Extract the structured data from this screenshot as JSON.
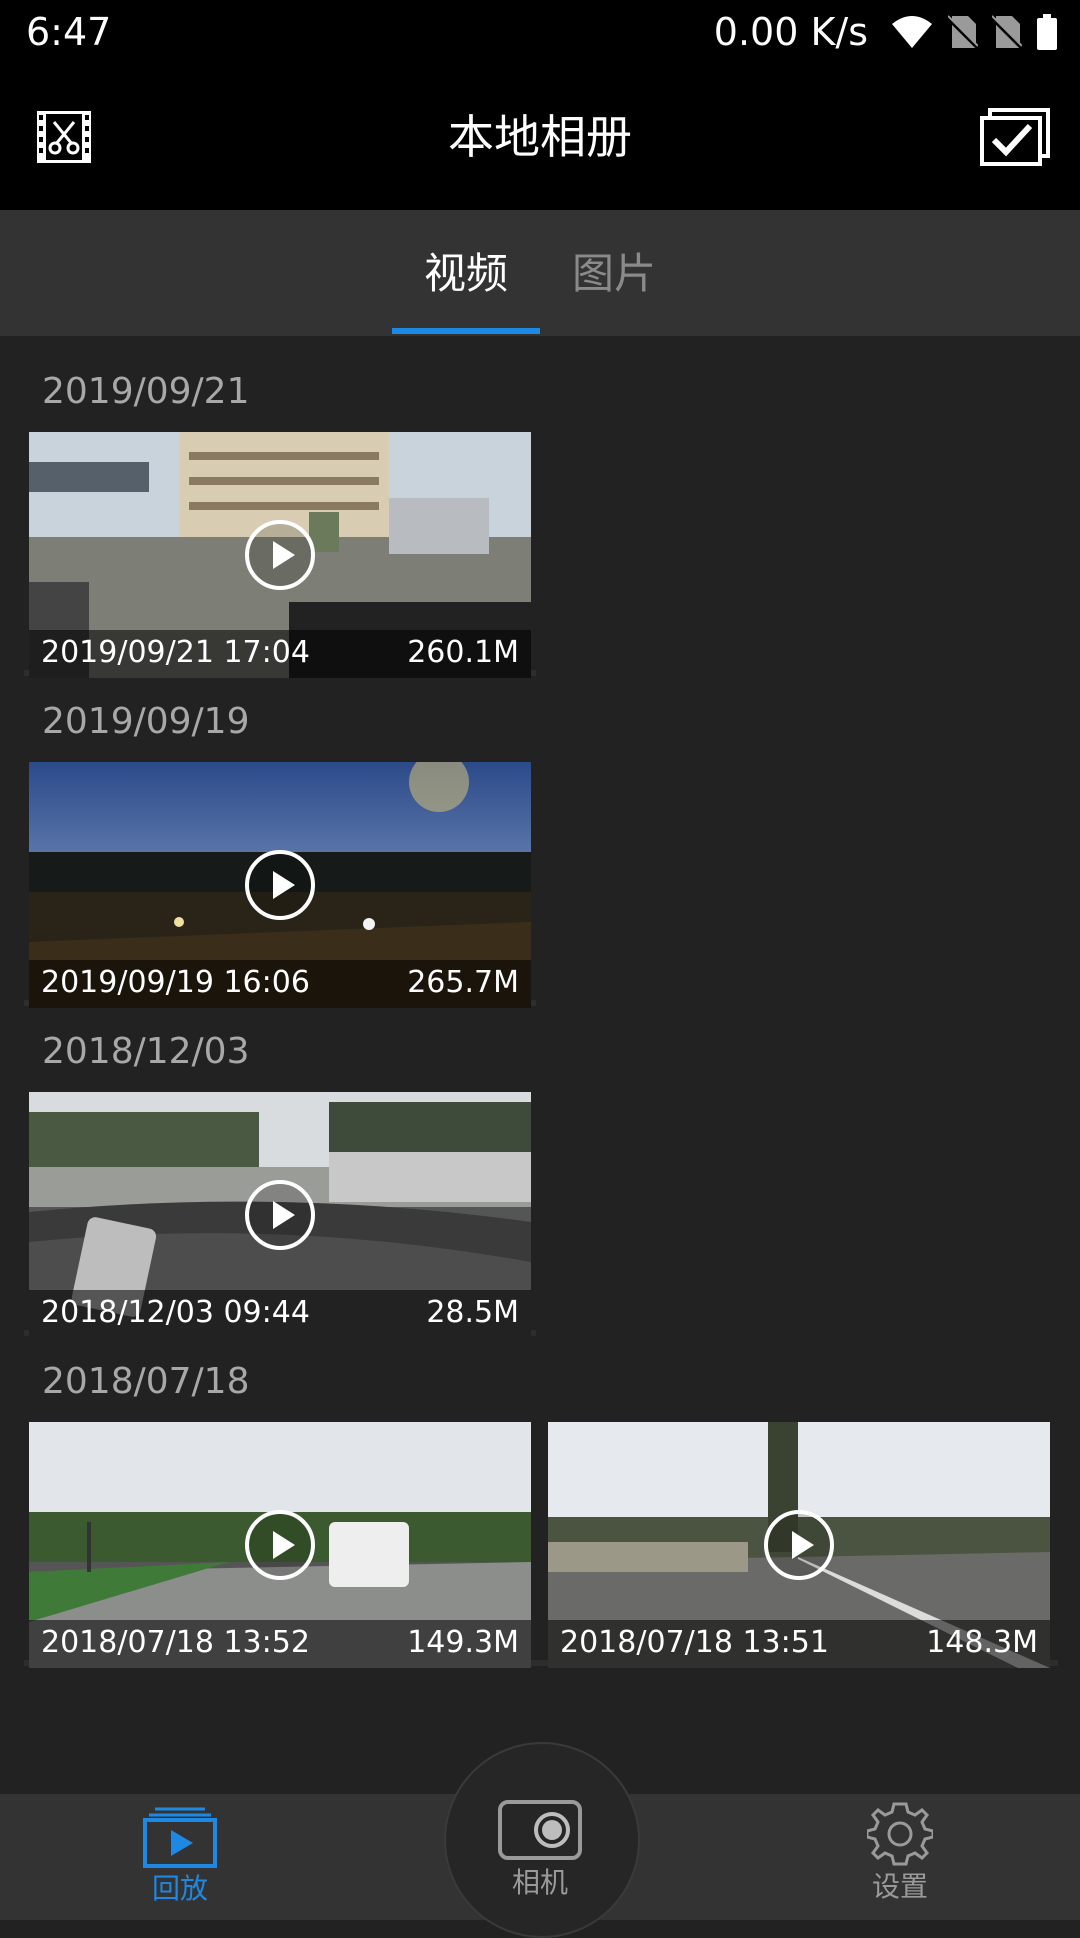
{
  "status_bar": {
    "time": "6:47",
    "speed": "0.00 K/s",
    "icons": [
      "wifi-icon",
      "no-sim-icon",
      "no-sim-icon",
      "battery-icon"
    ]
  },
  "toolbar": {
    "title": "本地相册",
    "left_icon": "video-edit-icon",
    "right_icon": "select-check-icon"
  },
  "tabs": [
    {
      "label": "视频",
      "active": true
    },
    {
      "label": "图片",
      "active": false
    }
  ],
  "colors": {
    "accent": "#1e88e5",
    "background": "#222222",
    "bar": "#333333"
  },
  "groups": [
    {
      "date": "2019/09/21",
      "items": [
        {
          "time": "2019/09/21 17:04",
          "size": "260.1M",
          "scene": "city-day"
        }
      ]
    },
    {
      "date": "2019/09/19",
      "items": [
        {
          "time": "2019/09/19 16:06",
          "size": "265.7M",
          "scene": "night"
        }
      ]
    },
    {
      "date": "2018/12/03",
      "items": [
        {
          "time": "2018/12/03 09:44",
          "size": "28.5M",
          "scene": "dashboard"
        }
      ]
    },
    {
      "date": "2018/07/18",
      "items": [
        {
          "time": "2018/07/18 13:52",
          "size": "149.3M",
          "scene": "road-van"
        },
        {
          "time": "2018/07/18 13:51",
          "size": "148.3M",
          "scene": "road-trees"
        }
      ]
    }
  ],
  "bottom_nav": [
    {
      "label": "回放",
      "icon": "playback-icon",
      "active": true
    },
    {
      "label": "相机",
      "icon": "camera-icon",
      "active": false
    },
    {
      "label": "设置",
      "icon": "settings-icon",
      "active": false
    }
  ]
}
